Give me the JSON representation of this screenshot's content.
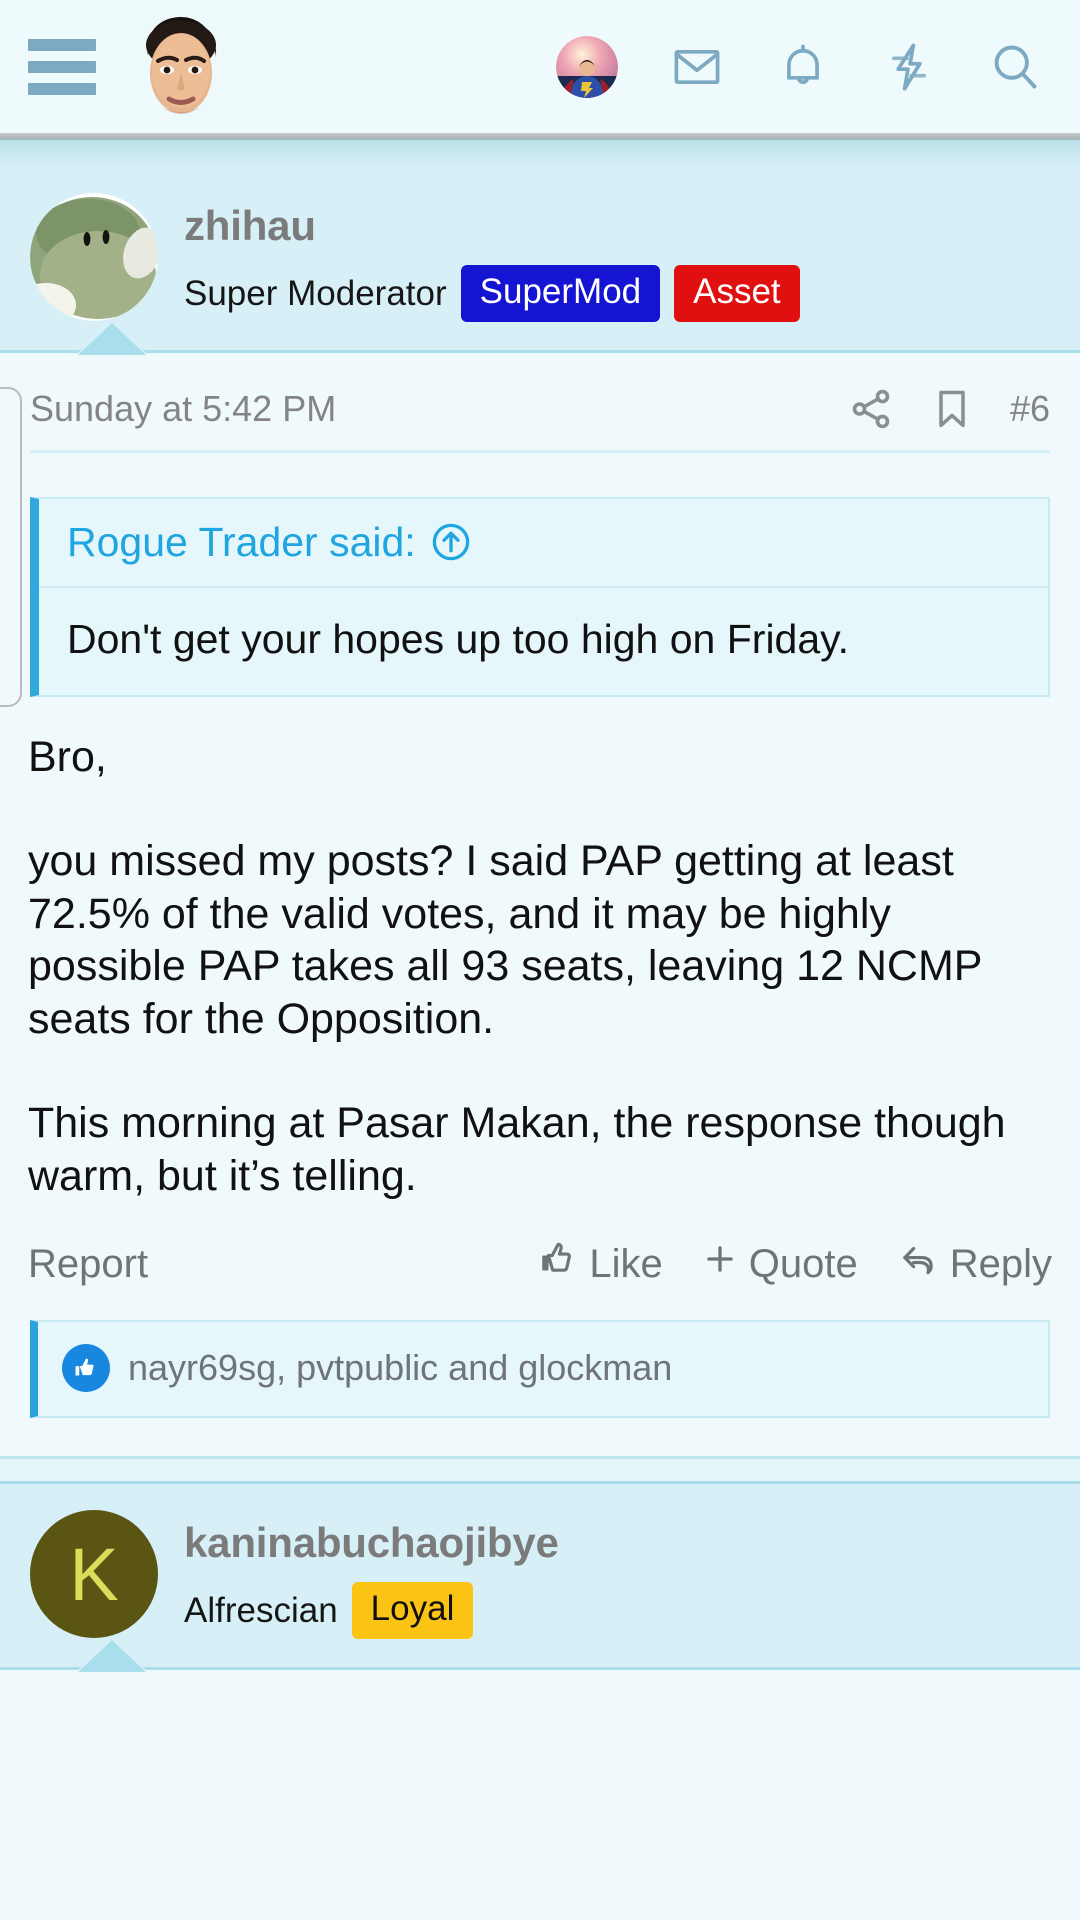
{
  "nav": {
    "menu_label": "menu",
    "icons": [
      {
        "name": "user-avatar",
        "label": "Account"
      },
      {
        "name": "envelope-icon",
        "label": "Inbox"
      },
      {
        "name": "bell-icon",
        "label": "Alerts"
      },
      {
        "name": "bolt-icon",
        "label": "What's new"
      },
      {
        "name": "search-icon",
        "label": "Search"
      }
    ]
  },
  "post": {
    "author": "zhihau",
    "user_title": "Super Moderator",
    "badges": [
      {
        "label": "SuperMod",
        "color": "#1414d2"
      },
      {
        "label": "Asset",
        "color": "#e01010"
      }
    ],
    "date": "Sunday at 5:42 PM",
    "post_number": "#6",
    "share_icon": "share-icon",
    "bookmark_icon": "bookmark-icon",
    "quote": {
      "author_line": "Rogue Trader said:",
      "jump_icon": "jump-to-post-icon",
      "text": "Don't get your hopes up too high on Friday."
    },
    "body": {
      "line1": "Bro,",
      "line2": "you missed my posts? I said PAP getting at least 72.5% of the valid votes, and it may be highly possible PAP takes all 93 seats, leaving 12 NCMP seats for the Opposition.",
      "line3": "This morning at Pasar Makan, the response though warm, but it’s telling."
    },
    "actions": {
      "report": "Report",
      "like": "Like",
      "quote": "Quote",
      "reply": "Reply"
    },
    "likes": {
      "text": "nayr69sg, pvtpublic and glockman",
      "icon": "thumbs-up-icon"
    }
  },
  "next_post": {
    "author": "kaninabuchaojibye",
    "avatar_letter": "K",
    "avatar_bg": "#5b5513",
    "avatar_fg": "#d8dd5a",
    "user_title": "Alfrescian",
    "badges": [
      {
        "label": "Loyal",
        "color": "#fbc314"
      }
    ]
  }
}
